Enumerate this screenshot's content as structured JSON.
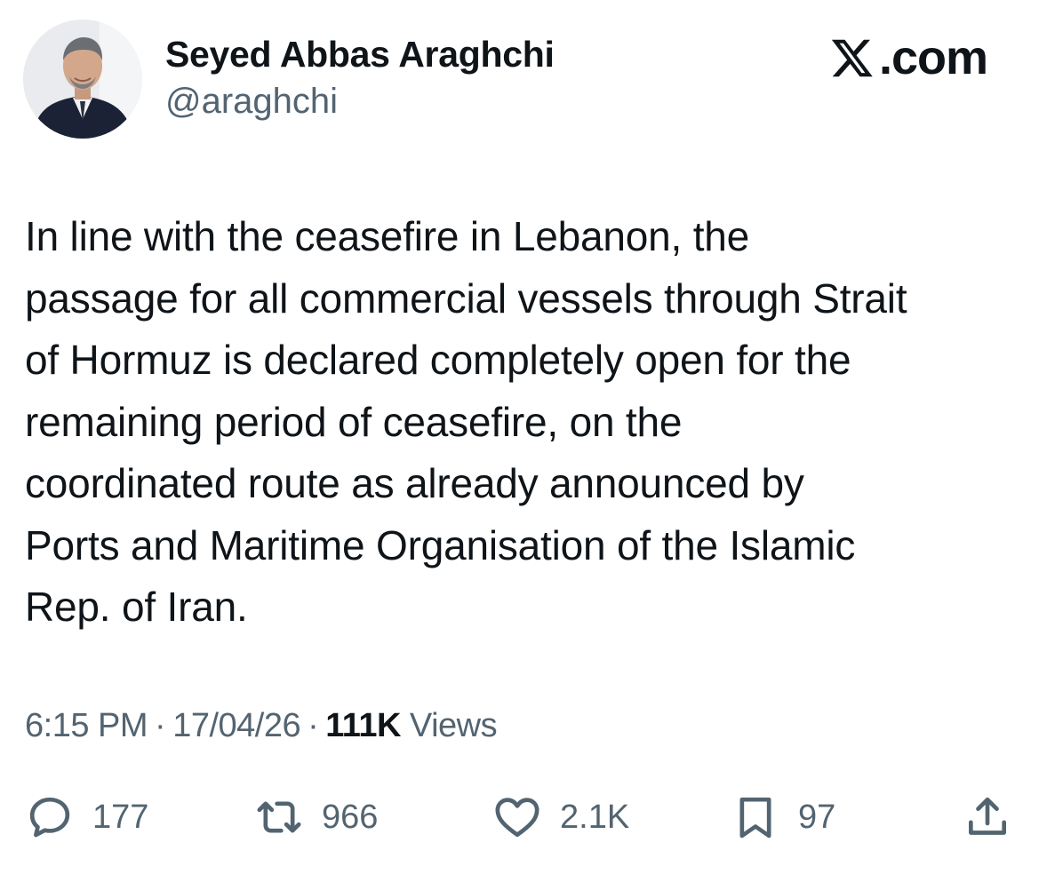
{
  "author": {
    "name": "Seyed Abbas Araghchi",
    "handle": "@araghchi"
  },
  "brand": {
    "label": ".com",
    "icon": "x-logo-icon"
  },
  "tweet": {
    "text": "In line with the ceasefire in Lebanon, the\npassage for all commercial vessels through Strait\nof Hormuz is declared completely open for the\nremaining period of ceasefire, on the\ncoordinated route as already announced by\nPorts and Maritime Organisation of the Islamic\nRep. of Iran."
  },
  "meta": {
    "time": "6:15 PM",
    "separator": "·",
    "date": "17/04/26",
    "views_count": "111K",
    "views_label": "Views"
  },
  "actions": {
    "replies": "177",
    "retweets": "966",
    "likes": "2.1K",
    "bookmarks": "97"
  },
  "colors": {
    "text_primary": "#0f1419",
    "text_secondary": "#536471",
    "background": "#ffffff"
  }
}
